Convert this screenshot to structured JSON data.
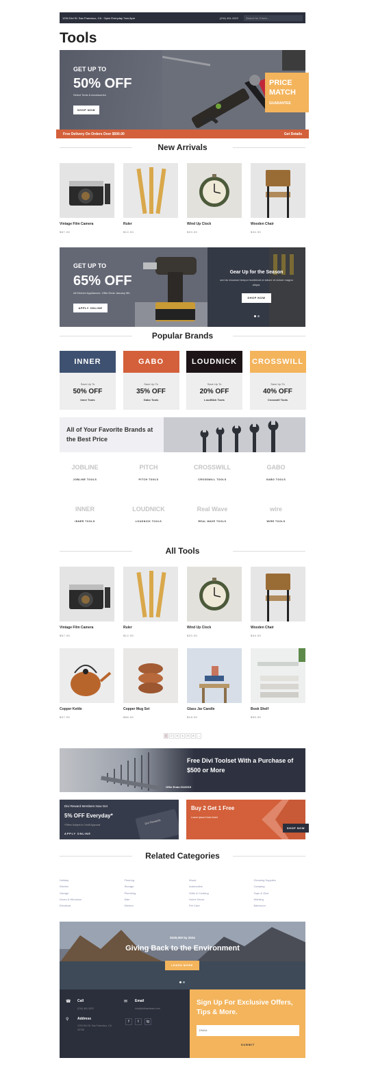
{
  "topbar": {
    "address": "1234 Divi St. San Francisco, CA · Open Everyday 7am-8pm",
    "phone": "(234) 461-2622",
    "search_placeholder": "Search for It here..."
  },
  "page": {
    "title": "Tools"
  },
  "hero": {
    "kicker": "GET UP TO",
    "headline": "50% OFF",
    "sub": "Select Tools & Accessories",
    "button": "SHOP NOW",
    "badge_line1": "PRICE",
    "badge_line2": "MATCH",
    "badge_line3": "GUARANTEE"
  },
  "delivery": {
    "left": "Free Delivery On Orders Over $500.00",
    "right": "Get Details"
  },
  "new_arrivals": {
    "title": "New Arrivals",
    "items": [
      {
        "name": "Vintage Film Camera",
        "price": "$67.00"
      },
      {
        "name": "Ruler",
        "price": "$12.00"
      },
      {
        "name": "Wind Up Clock",
        "price": "$20.00"
      },
      {
        "name": "Wooden Chair",
        "price": "$34.00"
      }
    ]
  },
  "promo": {
    "kicker": "GET UP TO",
    "headline": "65% OFF",
    "sub": "All Kitchen Appliances. Offer Ends January 5th",
    "button": "APPLY ONLINE"
  },
  "slider": {
    "title": "Gear Up for the Season",
    "text": "sed do eiusmod tempor incididunt ut labore et dolore magna aliqua.",
    "button": "SHOP NOW"
  },
  "popular_brands": {
    "title": "Popular Brands",
    "cards": [
      {
        "logo": "INNER",
        "label": "Save Up To",
        "pct": "50% OFF",
        "brand": "Inner Tools",
        "color": "#3e5171"
      },
      {
        "logo": "GABO",
        "label": "Save Up To",
        "pct": "35% OFF",
        "brand": "Gabo Tools",
        "color": "#d3603a"
      },
      {
        "logo": "LOUDNICK",
        "label": "Save Up To",
        "pct": "20% OFF",
        "brand": "LoudNick Tools",
        "color": "#1c1416"
      },
      {
        "logo": "CROSSWILL",
        "label": "Save Up To",
        "pct": "40% OFF",
        "brand": "Crosswill Tools",
        "color": "#f3b45c"
      }
    ]
  },
  "favorites": {
    "title": "All of Your Favorite Brands at the Best Price"
  },
  "brand_logos": [
    {
      "logo": "JOBLINE",
      "name": "JOBLINE TOOLS"
    },
    {
      "logo": "PITCH",
      "name": "PITCH TOOLS"
    },
    {
      "logo": "CROSSWILL",
      "name": "CROSSWILL TOOLS"
    },
    {
      "logo": "GABO",
      "name": "GABO TOOLS"
    },
    {
      "logo": "INNER",
      "name": "INNER TOOLS"
    },
    {
      "logo": "LOUDNICK",
      "name": "LOUDNICK TOOLS"
    },
    {
      "logo": "Real Wave",
      "name": "REAL WAVE TOOLS"
    },
    {
      "logo": "wire",
      "name": "WIRE TOOLS"
    }
  ],
  "all_tools": {
    "title": "All Tools",
    "items": [
      {
        "name": "Vintage Film Camera",
        "price": "$67.00"
      },
      {
        "name": "Ruler",
        "price": "$12.00"
      },
      {
        "name": "Wind Up Clock",
        "price": "$20.00"
      },
      {
        "name": "Wooden Chair",
        "price": "$34.00"
      },
      {
        "name": "Copper Kettle",
        "price": "$47.00"
      },
      {
        "name": "Copper Mug Set",
        "price": "$66.00"
      },
      {
        "name": "Glass Jar Candle",
        "price": "$18.00"
      },
      {
        "name": "Book Shelf",
        "price": "$99.00"
      }
    ]
  },
  "pagination": [
    "1",
    "2",
    "3",
    "4",
    "5",
    "6",
    "→"
  ],
  "toolset_banner": {
    "title": "Free Divi Toolset With a Purchase of $500 or More",
    "offer": "Offer Ends 01/20/19"
  },
  "reward": {
    "kicker": "Divi Reward Members Now Get",
    "headline": "5% OFF Everyday*",
    "note": "*Offers Subject to Credit Approval",
    "button": "APPLY ONLINE",
    "card": "Divi Rewards"
  },
  "b2g1": {
    "headline": "Buy 2 Get 1 Free",
    "sub": "Lorem Ipsum Dolor Amet",
    "button": "SHOP NOW"
  },
  "related": {
    "title": "Related Categories",
    "cols": [
      [
        "Holiday",
        "Kitchen",
        "Garage",
        "Doors & Windows",
        "Electrical"
      ],
      [
        "Flooring",
        "Storage",
        "Plumbing",
        "Sale",
        "Kitchen"
      ],
      [
        "Wood",
        "Automotive",
        "Grills & Cooking",
        "Home Decor",
        "Pet Care"
      ],
      [
        "Cleaning Supplies",
        "Camping",
        "Tape & Glue",
        "Welding",
        "Bathroom"
      ]
    ]
  },
  "environment": {
    "kicker": "$100,000 by 2024",
    "headline": "Giving Back to the Environment",
    "button": "LEARN MORE"
  },
  "footer": {
    "call_label": "Call",
    "call_value": "(234) 461-2622",
    "email_label": "Email",
    "email_value": "info@divihardware.com",
    "address_label": "Address",
    "address_value": "1234 Divi St. San Francisco, CA 93765",
    "social": [
      "f",
      "t",
      "ig"
    ]
  },
  "signup": {
    "title": "Sign Up For Exclusive Offers, Tips & More.",
    "placeholder": "EMAIL",
    "button": "SUBMIT"
  }
}
